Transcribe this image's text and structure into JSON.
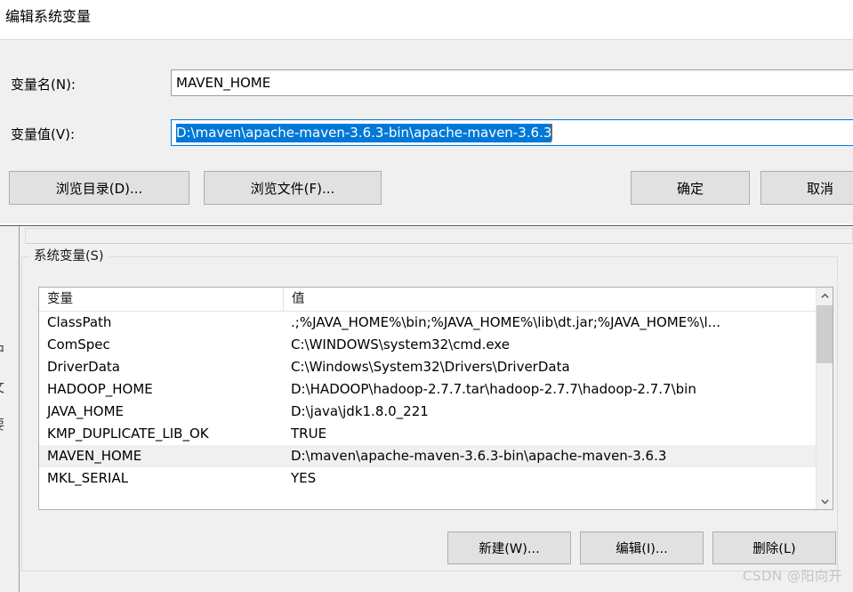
{
  "edit_dialog": {
    "title": "编辑系统变量",
    "name_label": "变量名(N):",
    "name_value": "MAVEN_HOME",
    "value_label": "变量值(V):",
    "value_value": "D:\\maven\\apache-maven-3.6.3-bin\\apache-maven-3.6.3",
    "browse_dir_label": "浏览目录(D)...",
    "browse_file_label": "浏览文件(F)...",
    "ok_label": "确定",
    "cancel_label": "取消",
    "selection_color": "#0078d7"
  },
  "background_window": {
    "left_edge_chars": "中\n文\n要",
    "group_label": "系统变量(S)",
    "table": {
      "columns": [
        "变量",
        "值"
      ],
      "selected_row_index": 6,
      "rows": [
        {
          "name": "ClassPath",
          "value": ".;%JAVA_HOME%\\bin;%JAVA_HOME%\\lib\\dt.jar;%JAVA_HOME%\\l..."
        },
        {
          "name": "ComSpec",
          "value": "C:\\WINDOWS\\system32\\cmd.exe"
        },
        {
          "name": "DriverData",
          "value": "C:\\Windows\\System32\\Drivers\\DriverData"
        },
        {
          "name": "HADOOP_HOME",
          "value": "D:\\HADOOP\\hadoop-2.7.7.tar\\hadoop-2.7.7\\hadoop-2.7.7\\bin"
        },
        {
          "name": "JAVA_HOME",
          "value": "D:\\java\\jdk1.8.0_221"
        },
        {
          "name": "KMP_DUPLICATE_LIB_OK",
          "value": "TRUE"
        },
        {
          "name": "MAVEN_HOME",
          "value": "D:\\maven\\apache-maven-3.6.3-bin\\apache-maven-3.6.3"
        },
        {
          "name": "MKL_SERIAL",
          "value": "YES"
        }
      ]
    },
    "buttons": {
      "new_label": "新建(W)...",
      "edit_label": "编辑(I)...",
      "delete_label": "删除(L)"
    }
  },
  "watermark": {
    "text": "CSDN @阳向开"
  }
}
